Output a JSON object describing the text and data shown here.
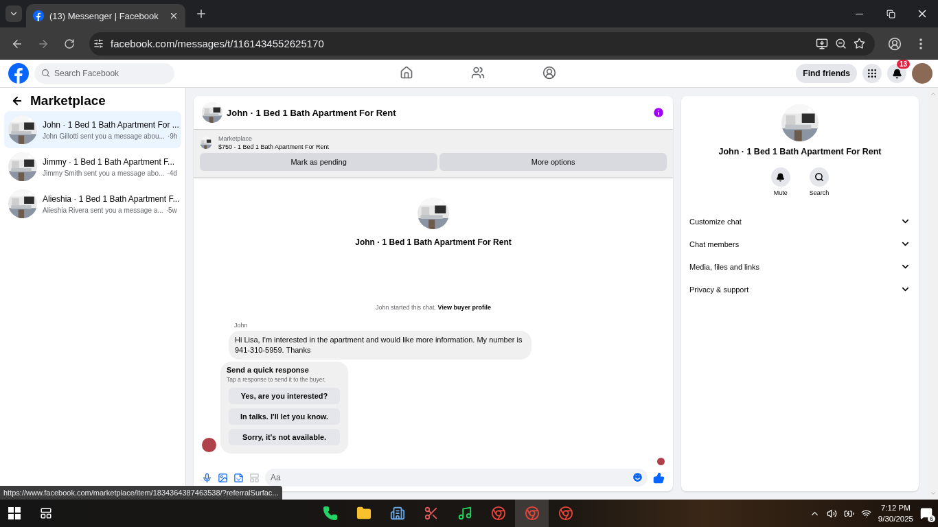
{
  "browser": {
    "tabs": [
      {
        "title": "(13) Messenger | Facebook",
        "selected": true
      }
    ],
    "url": "facebook.com/messages/t/1161434552625170"
  },
  "topnav": {
    "search_placeholder": "Search Facebook",
    "nav": [
      {
        "kind": "home",
        "selected": false
      },
      {
        "kind": "friends",
        "selected": false
      },
      {
        "kind": "groups",
        "selected": false
      }
    ],
    "find_friends": "Find friends",
    "notifications": "13"
  },
  "sidebar": {
    "title": "Marketplace",
    "conversations": [
      {
        "title": "John · 1 Bed 1 Bath Apartment For ...",
        "preview": "John Gillotti sent you a message abou...",
        "time": "·9h",
        "selected": true
      },
      {
        "title": "Jimmy · 1 Bed 1 Bath Apartment F...",
        "preview": "Jimmy Smith sent you a message abo...",
        "time": "·4d",
        "selected": false
      },
      {
        "title": "Alieshia · 1 Bed 1 Bath Apartment F...",
        "preview": "Alieshia Rivera sent you a message a...",
        "time": "·5w",
        "selected": false
      }
    ]
  },
  "chat": {
    "title": "John · 1 Bed 1 Bath Apartment For Rent",
    "listing": {
      "label": "Marketplace",
      "title": "$750 - 1 Bed 1 Bath Apartment For Rent"
    },
    "actions": [
      "Mark as pending",
      "More options"
    ],
    "intro_title": "John · 1 Bed 1 Bath Apartment For Rent",
    "started": "John started this chat.",
    "buyer_link": "View buyer profile",
    "sender": "John",
    "message": "Hi Lisa, I'm interested in the apartment and would like more information.  My number is 941-310-5959.  Thanks",
    "quick": {
      "title": "Send a quick response",
      "hint": "Tap a response to send it to the buyer.",
      "responses": [
        "Yes, are you interested?",
        "In talks. I'll let you know.",
        "Sorry, it's not available."
      ]
    },
    "composer_placeholder": "Aa"
  },
  "details": {
    "title": "John · 1 Bed 1 Bath Apartment For Rent",
    "actions": [
      {
        "kind": "mute",
        "label": "Mute"
      },
      {
        "kind": "search",
        "label": "Search"
      }
    ],
    "sections": [
      "Customize chat",
      "Chat members",
      "Media, files and links",
      "Privacy & support"
    ]
  },
  "status_url": "https://www.facebook.com/marketplace/item/1834364387463538/?referralSurfac...",
  "taskbar": {
    "apps": [
      {
        "kind": "whatsapp",
        "selected": false
      },
      {
        "kind": "files",
        "selected": false
      },
      {
        "kind": "city",
        "selected": false
      },
      {
        "kind": "scissors",
        "selected": false
      },
      {
        "kind": "spotify",
        "selected": false
      },
      {
        "kind": "chrome",
        "selected": false
      },
      {
        "kind": "chrome",
        "selected": true
      },
      {
        "kind": "chrome",
        "selected": false
      }
    ],
    "time": "7:12 PM",
    "date": "9/30/2025",
    "notifications": "6"
  }
}
